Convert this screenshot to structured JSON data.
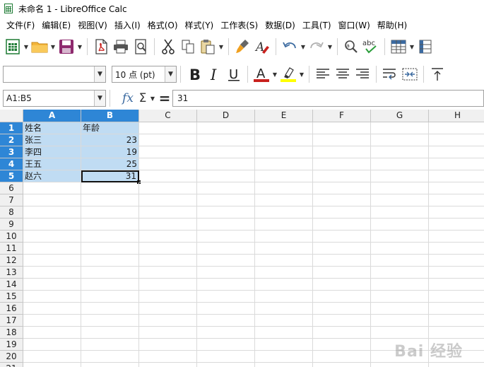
{
  "window": {
    "title": "未命名 1 - LibreOffice Calc"
  },
  "menu": [
    "文件(F)",
    "编辑(E)",
    "视图(V)",
    "插入(I)",
    "格式(O)",
    "样式(Y)",
    "工作表(S)",
    "数据(D)",
    "工具(T)",
    "窗口(W)",
    "帮助(H)"
  ],
  "format_bar": {
    "font_name": "",
    "font_size": "10 点 (pt)"
  },
  "formula_bar": {
    "cell_ref": "A1:B5",
    "formula": "31"
  },
  "colors": {
    "accent": "#2e86d6",
    "selection": "#c0dcf3",
    "font_color": "#c9211e",
    "highlight": "#ffff00"
  },
  "sheet": {
    "columns": [
      "A",
      "B",
      "C",
      "D",
      "E",
      "F",
      "G",
      "H"
    ],
    "rows": [
      "1",
      "2",
      "3",
      "4",
      "5",
      "6",
      "7",
      "8",
      "9",
      "10",
      "11",
      "12",
      "13",
      "14",
      "15",
      "16",
      "17",
      "18",
      "19",
      "20",
      "21"
    ],
    "cells": [
      [
        "姓名",
        "年龄"
      ],
      [
        "张三",
        "23"
      ],
      [
        "李四",
        "19"
      ],
      [
        "王五",
        "25"
      ],
      [
        "赵六",
        "31"
      ]
    ]
  },
  "watermark": "Bai 经验"
}
